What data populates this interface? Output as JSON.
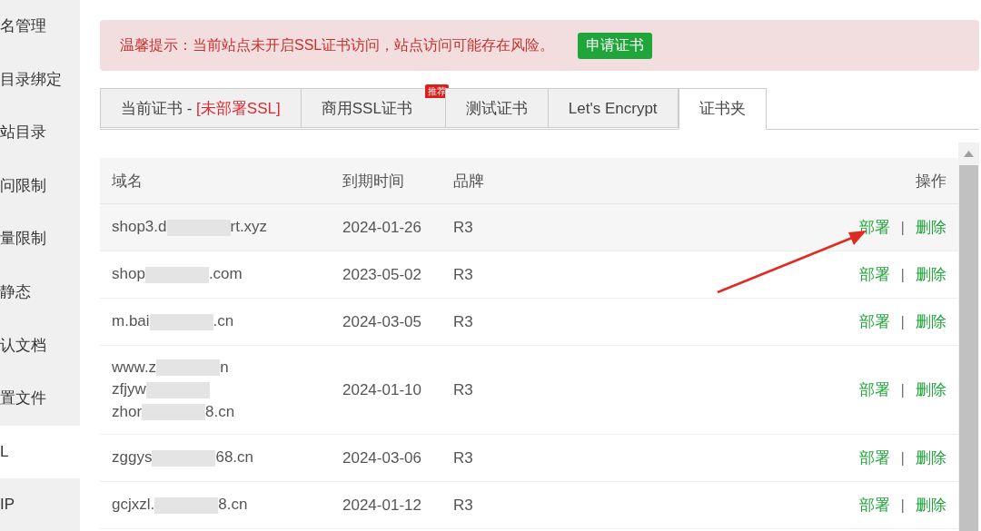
{
  "sidebar": {
    "items": [
      {
        "label": "名管理",
        "selected": false
      },
      {
        "label": "目录绑定",
        "selected": false
      },
      {
        "label": "站目录",
        "selected": false
      },
      {
        "label": "问限制",
        "selected": false
      },
      {
        "label": "量限制",
        "selected": false
      },
      {
        "label": "静态",
        "selected": false
      },
      {
        "label": "认文档",
        "selected": false
      },
      {
        "label": "置文件",
        "selected": false
      },
      {
        "label": "L",
        "selected": true
      },
      {
        "label": "IP",
        "selected": false
      }
    ]
  },
  "alert": {
    "message": "温馨提示：当前站点未开启SSL证书访问，站点访问可能存在风险。",
    "button": "申请证书"
  },
  "tabs": [
    {
      "label": "当前证书 - ",
      "status": "[未部署SSL]",
      "selected": false
    },
    {
      "label": "商用SSL证书",
      "badge": "推荐",
      "selected": false
    },
    {
      "label": "测试证书",
      "selected": false
    },
    {
      "label": "Let's Encrypt",
      "selected": false
    },
    {
      "label": "证书夹",
      "selected": true
    }
  ],
  "table": {
    "columns": [
      "域名",
      "到期时间",
      "品牌",
      "操作"
    ],
    "rows": [
      {
        "domain_lines": [
          [
            "shop3.d",
            "rt.xyz"
          ]
        ],
        "expires": "2024-01-26",
        "brand": "R3",
        "actions": [
          "部署",
          "|",
          "删除"
        ]
      },
      {
        "domain_lines": [
          [
            "shop",
            ".com"
          ]
        ],
        "expires": "2023-05-02",
        "brand": "R3",
        "actions": [
          "部署",
          "|",
          "删除"
        ]
      },
      {
        "domain_lines": [
          [
            "m.bai",
            ".cn"
          ]
        ],
        "expires": "2024-03-05",
        "brand": "R3",
        "actions": [
          "部署",
          "|",
          "删除"
        ]
      },
      {
        "domain_lines": [
          [
            "www.z",
            "n"
          ],
          [
            "zfjyw"
          ],
          [
            "zhor",
            "8.cn"
          ]
        ],
        "expires": "2024-01-10",
        "brand": "R3",
        "actions": [
          "部署",
          "|",
          "删除"
        ]
      },
      {
        "domain_lines": [
          [
            "zggys",
            "68.cn"
          ]
        ],
        "expires": "2024-03-06",
        "brand": "R3",
        "actions": [
          "部署",
          "|",
          "删除"
        ]
      },
      {
        "domain_lines": [
          [
            "gcjxzl.",
            "8.cn"
          ]
        ],
        "expires": "2024-01-12",
        "brand": "R3",
        "actions": [
          "部署",
          "|",
          "删除"
        ]
      }
    ]
  },
  "annotations": [
    {
      "kind": "arrow"
    }
  ]
}
